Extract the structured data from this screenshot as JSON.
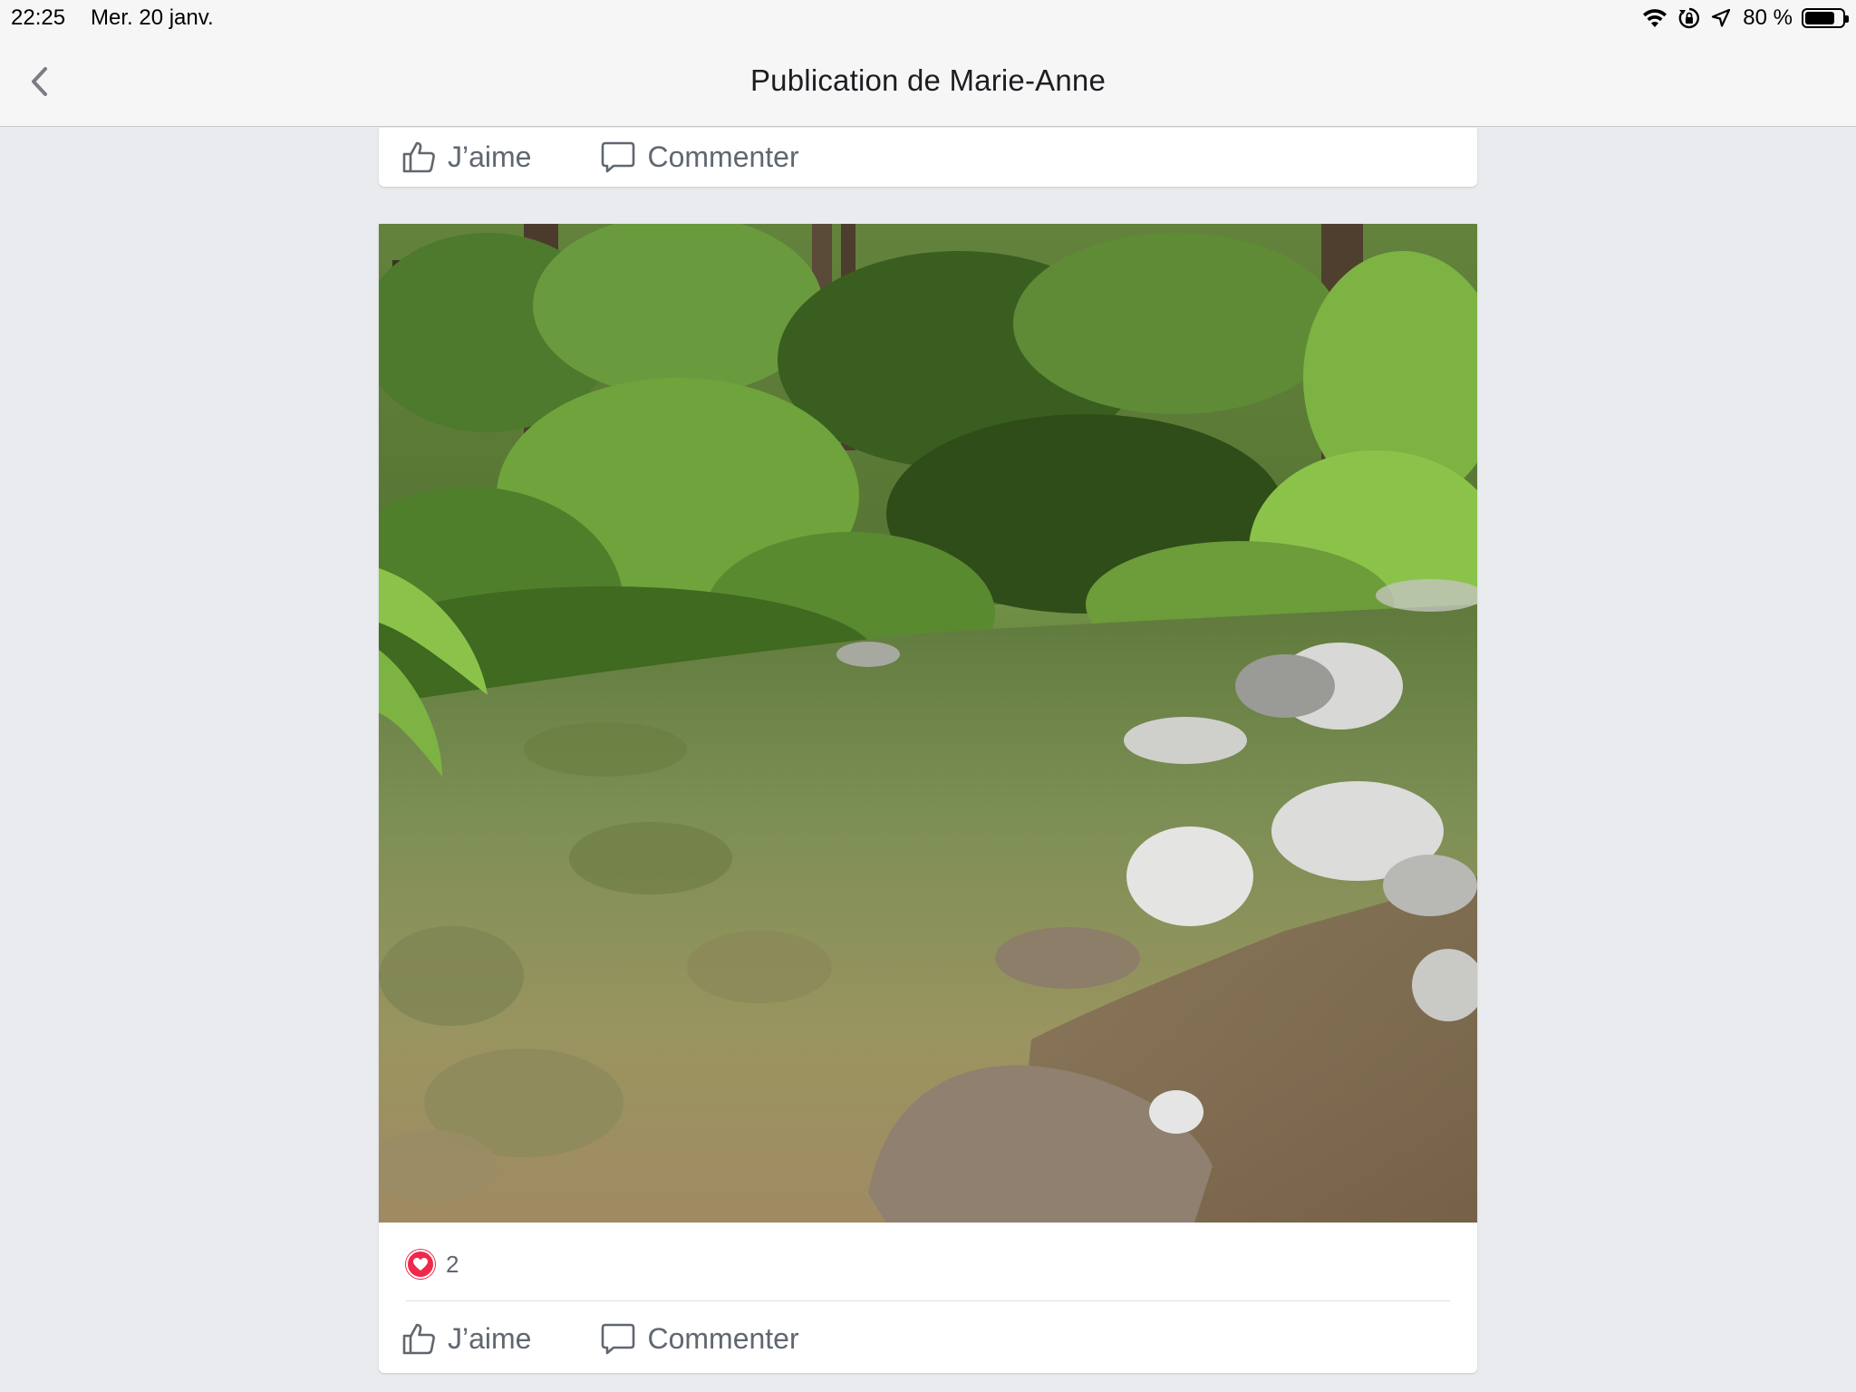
{
  "status_bar": {
    "time": "22:25",
    "date": "Mer. 20 janv.",
    "battery_percent": "80 %",
    "battery_level": 0.8,
    "icons": [
      "wifi-icon",
      "orientation-lock-icon",
      "location-icon",
      "battery-icon"
    ]
  },
  "nav": {
    "title": "Publication de Marie-Anne",
    "back_icon": "chevron-left-icon"
  },
  "actions": {
    "like_label": "J’aime",
    "comment_label": "Commenter"
  },
  "post": {
    "photo_subject": "river-stream-forest-photo",
    "reaction_icon": "heart-icon",
    "reaction_count": "2"
  },
  "colors": {
    "background": "#e9ebee",
    "bar": "#f6f6f7",
    "action_text": "#606770",
    "love": "#f0284a"
  }
}
